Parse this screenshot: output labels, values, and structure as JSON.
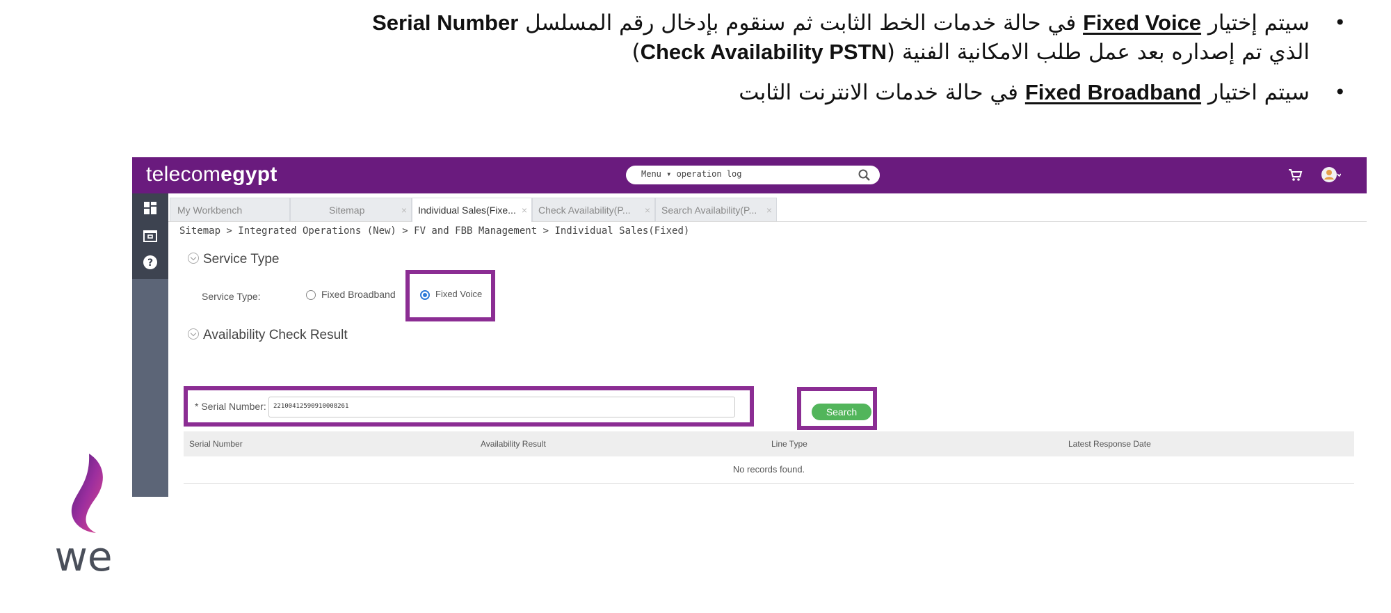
{
  "instructions": {
    "bullet1_pre": "سيتم إختيار ",
    "bullet1_en1": "Fixed Voice",
    "bullet1_mid": " في حالة خدمات الخط الثابت ثم سنقوم بإدخال رقم المسلسل ",
    "bullet1_en2": "Serial Number",
    "bullet1_line2": " الذي تم إصداره بعد عمل طلب الامكانية الفنية (",
    "bullet1_en3": "Check Availability PSTN",
    "bullet1_close": ")",
    "bullet2_pre": "سيتم اختيار ",
    "bullet2_en": "Fixed Broadband",
    "bullet2_post": " في حالة خدمات الانترنت الثابت"
  },
  "app": {
    "brand_light": "telecom",
    "brand_bold": "egypt",
    "menu_search": "Menu ▾ operation log",
    "tabs": [
      {
        "label": "My Workbench",
        "closable": false
      },
      {
        "label": "Sitemap",
        "closable": true
      },
      {
        "label": "Individual Sales(Fixe...",
        "closable": true,
        "active": true
      },
      {
        "label": "Check Availability(P...",
        "closable": true
      },
      {
        "label": "Search Availability(P...",
        "closable": true
      }
    ],
    "breadcrumb": "Sitemap > Integrated Operations (New) > FV and FBB Management > Individual Sales(Fixed)",
    "service_type_section": "Service Type",
    "service_type_label": "Service Type:",
    "options": {
      "fixed_broadband": "Fixed Broadband",
      "fixed_voice": "Fixed Voice",
      "selected": "Fixed Voice"
    },
    "availability_section": "Availability Check Result",
    "serial_label": "* Serial Number:",
    "serial_value": "22100412590910008261",
    "search_button": "Search",
    "grid_columns": [
      "Serial Number",
      "Availability Result",
      "Line Type",
      "Latest Response Date"
    ],
    "no_records": "No records found."
  },
  "colors": {
    "brand_purple": "#6a1b7e",
    "highlight": "#8b2d93",
    "search_green": "#52b55b",
    "radio_blue": "#2f7bd8"
  },
  "logo": {
    "text": "we"
  }
}
